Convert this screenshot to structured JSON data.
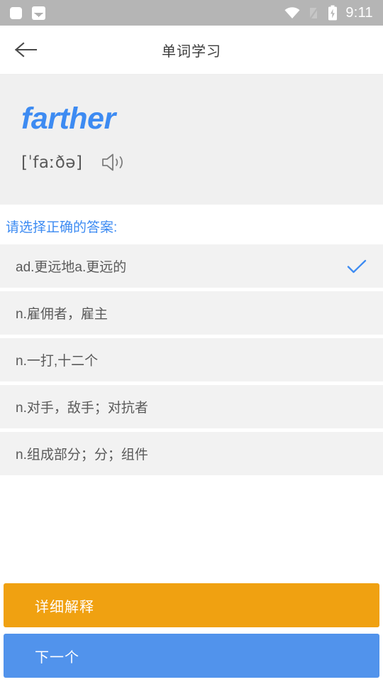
{
  "statusbar": {
    "time": "9:11",
    "icons": [
      "rounded-square-notification-icon",
      "photo-notification-icon",
      "wifi-icon",
      "no-signal-icon",
      "battery-charging-icon"
    ]
  },
  "appbar": {
    "title": "单词学习",
    "back_icon": "back-arrow-icon"
  },
  "wordcard": {
    "word": "farther",
    "phonetic": "[ˈfaːðə]",
    "speaker_icon": "speaker-icon",
    "word_color": "#3d8bf2",
    "background": "#f0f0f0"
  },
  "quiz": {
    "hint": "请选择正确的答案:",
    "hint_color": "#3d8bf2",
    "check_icon": "check-icon",
    "check_color": "#3d8bf2",
    "options": [
      {
        "text": "ad.更远地a.更远的",
        "selected": true
      },
      {
        "text": "n.雇佣者，雇主",
        "selected": false
      },
      {
        "text": "n.一打,十二个",
        "selected": false
      },
      {
        "text": "n.对手，敌手；对抗者",
        "selected": false
      },
      {
        "text": "n.组成部分；分；组件",
        "selected": false
      }
    ]
  },
  "bottom": {
    "detail_label": "详细解释",
    "detail_color": "#f0a111",
    "next_label": "下一个",
    "next_color": "#5193ec"
  }
}
